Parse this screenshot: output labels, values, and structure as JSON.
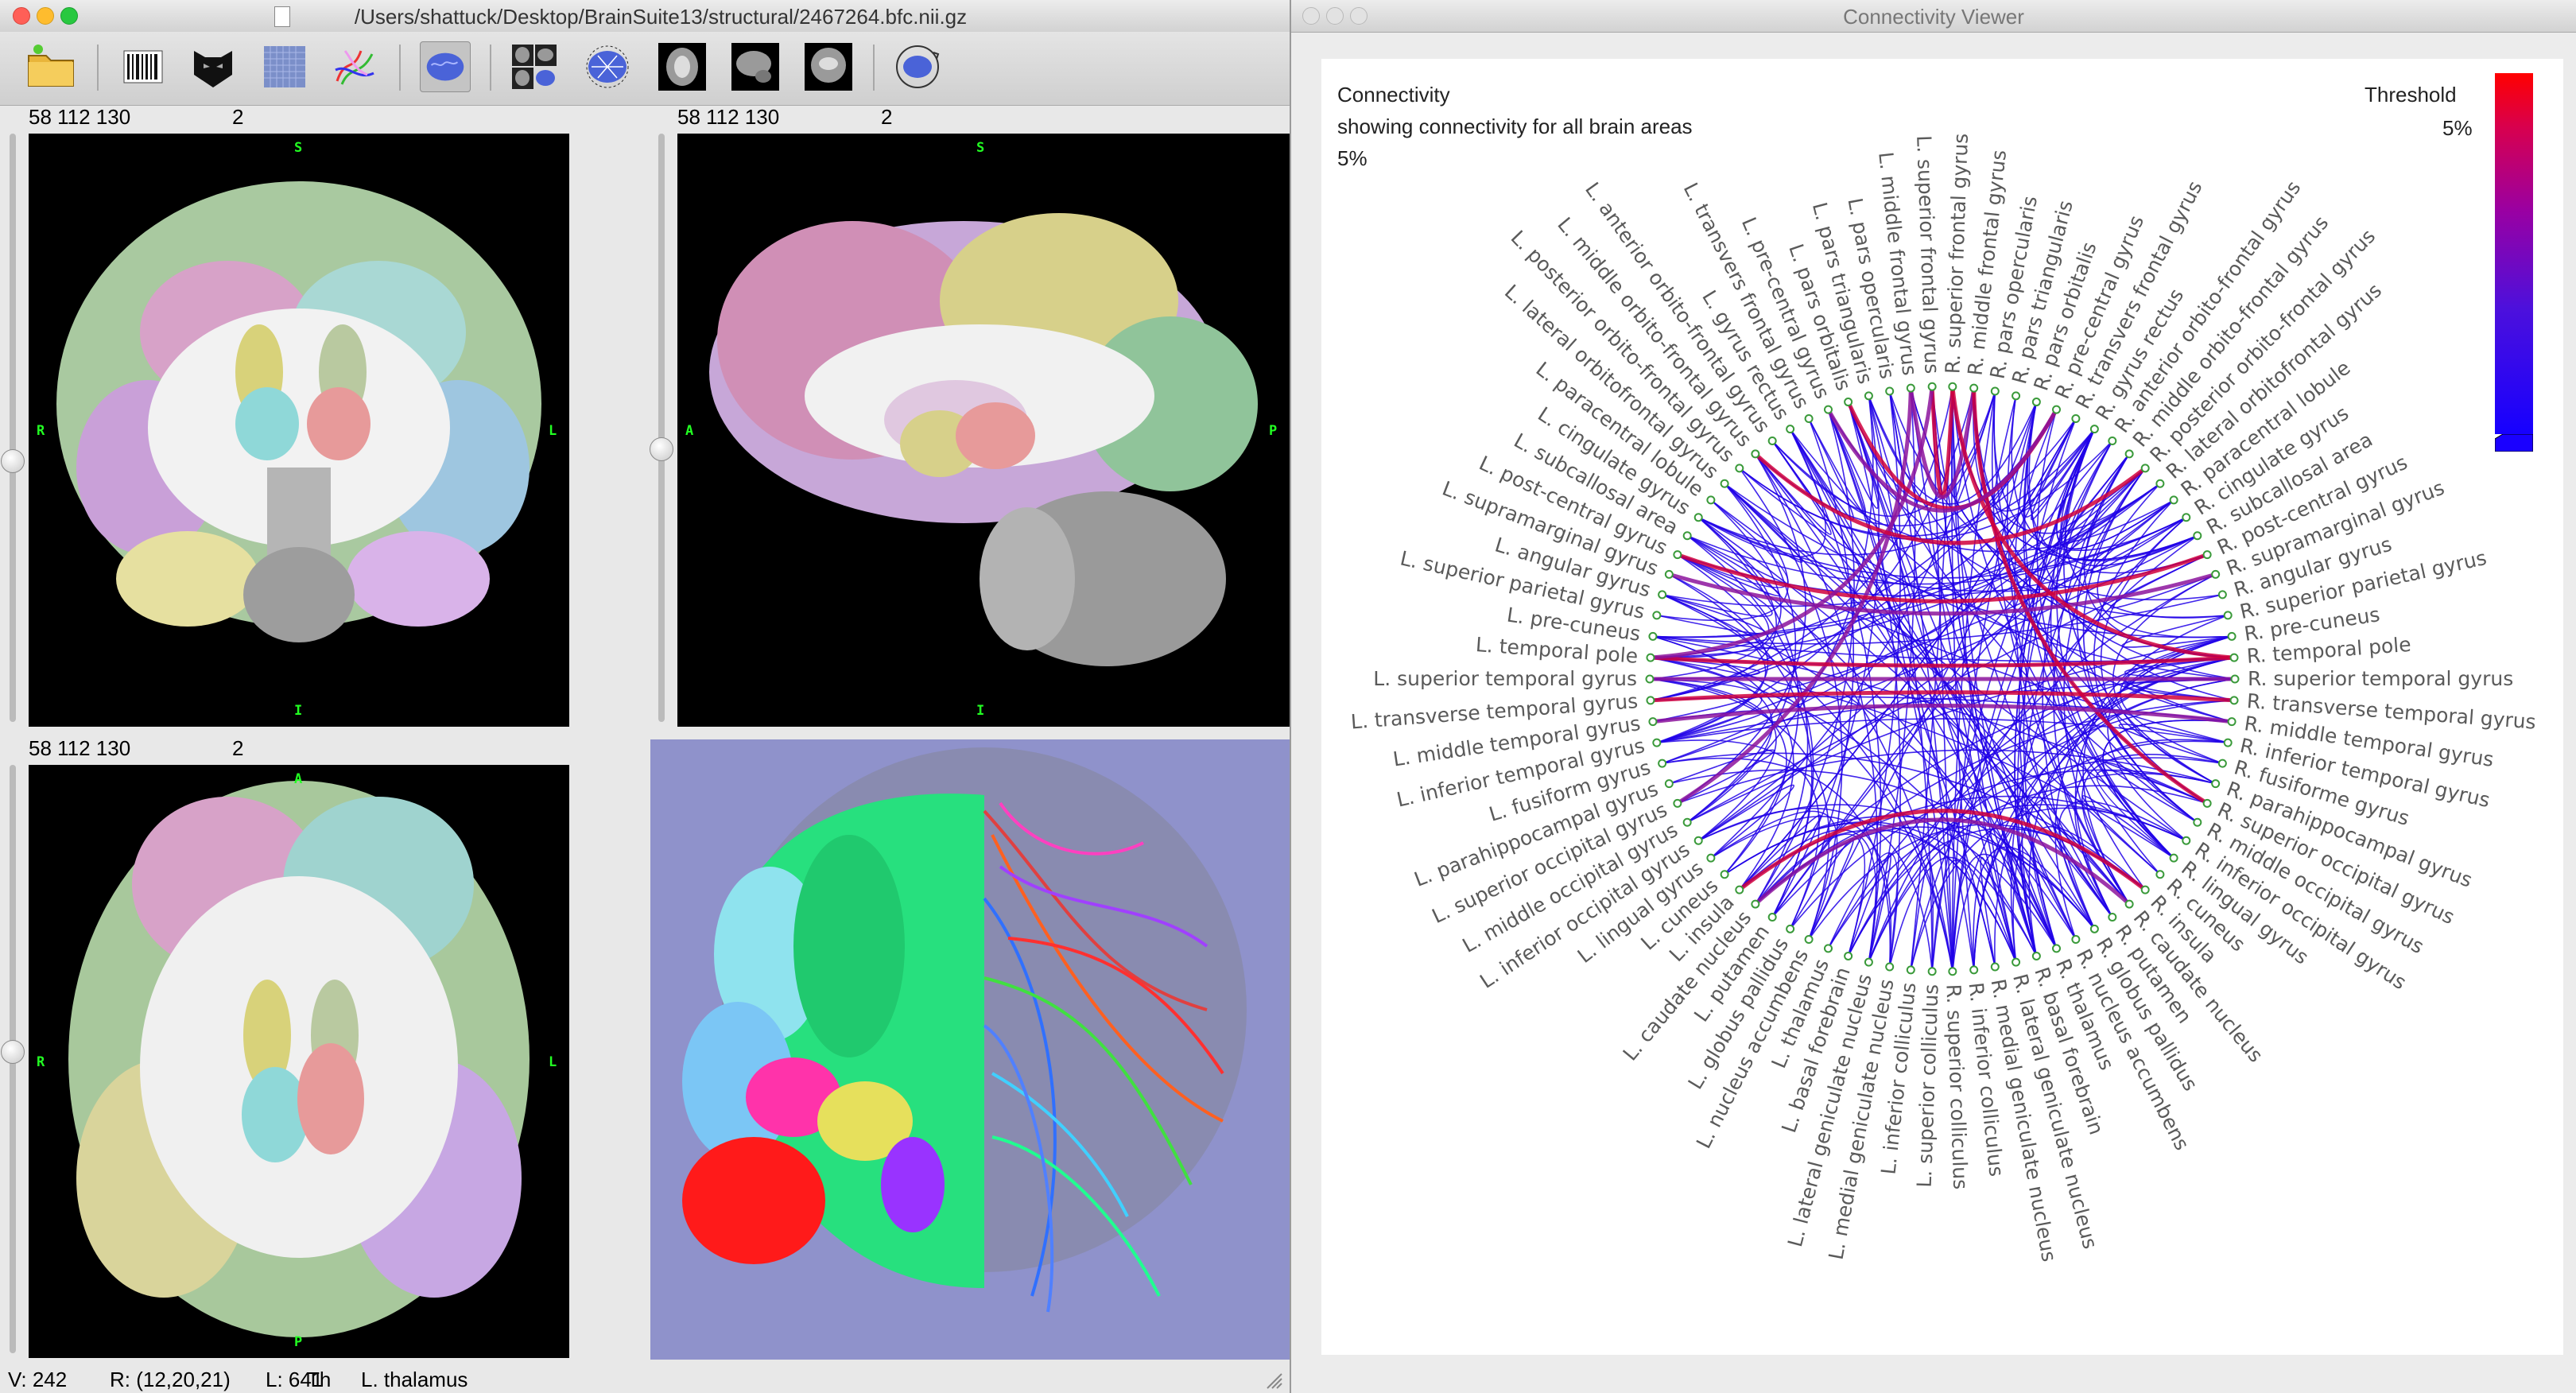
{
  "left_window": {
    "title": "/Users/shattuck/Desktop/BrainSuite13/structural/2467264.bfc.nii.gz",
    "toolbar_icons": [
      "open-folder-icon",
      "barcode-icon",
      "mask-icon",
      "grid-volume-icon",
      "fiber-tract-icon",
      "surface-icon",
      "multi-view-icon",
      "connectivity-icon",
      "axial-slice-icon",
      "sagittal-slice-icon",
      "coronal-slice-icon",
      "rotate-surface-icon"
    ],
    "views": [
      {
        "name": "coronal",
        "coords": "58 112 130",
        "value": "2",
        "top": "S",
        "bottom": "I",
        "left": "R",
        "right": "L"
      },
      {
        "name": "sagittal",
        "coords": "58 112 130",
        "value": "2",
        "top": "S",
        "bottom": "I",
        "left": "A",
        "right": "P"
      },
      {
        "name": "axial",
        "coords": "58 112 130",
        "value": "2",
        "top": "A",
        "bottom": "P",
        "left": "R",
        "right": "L"
      }
    ],
    "status": {
      "v": "V: 242",
      "r": "R: (12,20,21)",
      "l": "L: 641",
      "th": "Th",
      "label": "L. thalamus"
    }
  },
  "connectivity_viewer": {
    "title": "Connectivity Viewer",
    "heading": "Connectivity",
    "subheading": "showing connectivity for all brain areas",
    "percent": "5%",
    "threshold_label": "Threshold",
    "threshold_value": "5%",
    "colors": {
      "strong": "#d0003c",
      "mid": "#8c149c",
      "weak": "#2000e8"
    },
    "regions_right": [
      "R. superior frontal gyrus",
      "R. middle frontal gyrus",
      "R. pars opercularis",
      "R. pars triangularis",
      "R. pars orbitalis",
      "R. pre-central gyrus",
      "R. transvers frontal gyrus",
      "R. gyrus rectus",
      "R. anterior orbito-frontal gyrus",
      "R. middle orbito-frontal gyrus",
      "R. posterior orbito-frontal gyrus",
      "R. lateral orbitofrontal gyrus",
      "R. paracentral lobule",
      "R. cingulate gyrus",
      "R. subcallosal area",
      "R. post-central gyrus",
      "R. supramarginal gyrus",
      "R. angular gyrus",
      "R. superior parietal gyrus",
      "R. pre-cuneus",
      "R. temporal pole",
      "R. superior temporal gyrus",
      "R. transverse temporal gyrus",
      "R. middle temporal gyrus",
      "R. inferior temporal gyrus",
      "R. fusiforme gyrus",
      "R. parahippocampal gyrus",
      "R. superior occipital gyrus",
      "R. middle occipital gyrus",
      "R. inferior occipital gyrus",
      "R. lingual gyrus",
      "R. cuneus",
      "R. insula",
      "R. caudate nucleus",
      "R. putamen",
      "R. globus pallidus",
      "R. nucleus accumbens",
      "R. thalamus",
      "R. basal forebrain",
      "R. lateral geniculate nucleus",
      "R. medial geniculate nucleus",
      "R. inferior colliculus",
      "R. superior colliculus"
    ],
    "regions_left": [
      "L. superior frontal gyrus",
      "L. middle frontal gyrus",
      "L. pars opercularis",
      "L. pars triangularis",
      "L. pars orbitalis",
      "L. pre-central gyrus",
      "L. transvers frontal gyrus",
      "L. gyrus rectus",
      "L. anterior orbito-frontal gyrus",
      "L. middle orbito-frontal gyrus",
      "L. posterior orbito-frontal gyrus",
      "L. lateral orbitofrontal gyrus",
      "L. paracentral lobule",
      "L. cingulate gyrus",
      "L. subcallosal area",
      "L. post-central gyrus",
      "L. supramarginal gyrus",
      "L. angular gyrus",
      "L. superior parietal gyrus",
      "L. pre-cuneus",
      "L. temporal pole",
      "L. superior temporal gyrus",
      "L. transverse temporal gyrus",
      "L. middle temporal gyrus",
      "L. inferior temporal gyrus",
      "L. fusiform gyrus",
      "L. parahippocampal gyrus",
      "L. superior occipital gyrus",
      "L. middle occipital gyrus",
      "L. inferior occipital gyrus",
      "L. lingual gyrus",
      "L. cuneus",
      "L. insula",
      "L. caudate nucleus",
      "L. putamen",
      "L. globus pallidus",
      "L. nucleus accumbens",
      "L. thalamus",
      "L. basal forebrain",
      "L. lateral geniculate nucleus",
      "L. medial geniculate nucleus",
      "L. inferior colliculus",
      "L. superior colliculus"
    ],
    "strong_links": [
      [
        0,
        43
      ],
      [
        1,
        44
      ],
      [
        1,
        27
      ],
      [
        44,
        70
      ],
      [
        15,
        58
      ],
      [
        16,
        59
      ],
      [
        20,
        63
      ],
      [
        21,
        64
      ],
      [
        22,
        65
      ],
      [
        23,
        66
      ],
      [
        32,
        75
      ],
      [
        33,
        76
      ],
      [
        0,
        20
      ],
      [
        43,
        63
      ],
      [
        5,
        47
      ],
      [
        48,
        5
      ],
      [
        10,
        52
      ]
    ]
  }
}
